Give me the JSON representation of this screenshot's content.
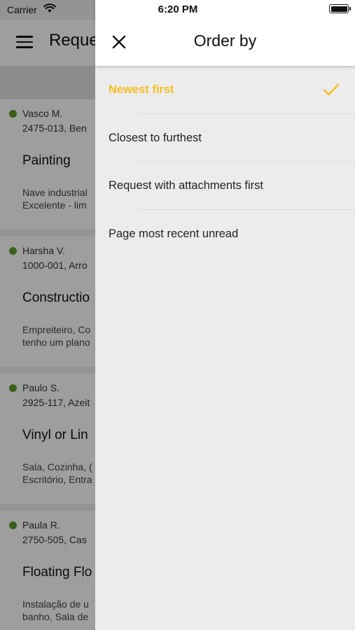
{
  "status_bar": {
    "carrier": "Carrier",
    "time": "6:20 PM"
  },
  "background": {
    "title": "Reque",
    "requests": [
      {
        "name": "Vasco M.",
        "location": "2475-013, Ben",
        "service": "Painting",
        "desc_line1": "Nave industrial",
        "desc_line2": "Excelente - lim"
      },
      {
        "name": "Harsha V.",
        "location": "1000-001, Arro",
        "service": "Constructio",
        "desc_line1": "Empreiteiro, Co",
        "desc_line2": "tenho um plano"
      },
      {
        "name": "Paulo S.",
        "location": "2925-117, Azeit",
        "service": "Vinyl or Lin",
        "desc_line1": "Sala, Cozinha, (",
        "desc_line2": "Escritório, Entra"
      },
      {
        "name": "Paula R.",
        "location": "2750-505, Cas",
        "service": "Floating Flo",
        "desc_line1": "Instalação de u",
        "desc_line2": "banho, Sala de"
      }
    ]
  },
  "drawer": {
    "title": "Order by",
    "options": [
      {
        "label": "Newest first",
        "selected": true
      },
      {
        "label": "Closest to furthest",
        "selected": false
      },
      {
        "label": "Request with attachments first",
        "selected": false
      },
      {
        "label": "Page most recent unread",
        "selected": false
      }
    ]
  },
  "colors": {
    "accent": "#f5be1e",
    "online_dot": "#5e9b2b"
  }
}
